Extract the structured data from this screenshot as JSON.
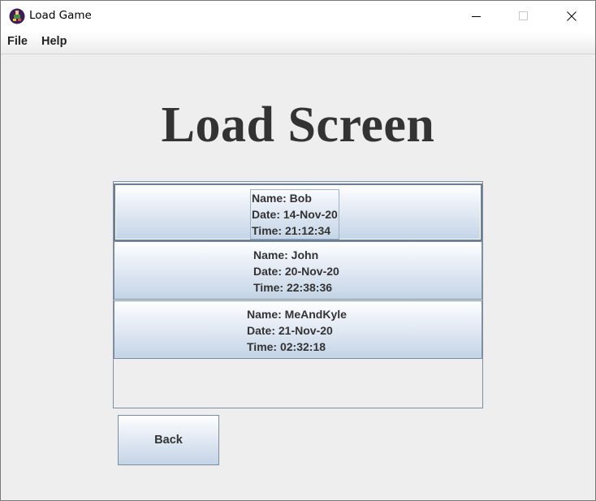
{
  "window": {
    "title": "Load Game",
    "icon": "game-app-icon",
    "controls": {
      "minimize_icon": "minimize-icon",
      "maximize_icon": "maximize-icon",
      "close_icon": "close-icon"
    }
  },
  "menu": {
    "items": [
      {
        "label": "File"
      },
      {
        "label": "Help"
      }
    ]
  },
  "heading": "Load Screen",
  "saves": [
    {
      "name": "Name: Bob",
      "date": "Date: 14-Nov-20",
      "time": "Time: 21:12:34",
      "selected": true
    },
    {
      "name": "Name: John",
      "date": "Date: 20-Nov-20",
      "time": "Time: 22:38:36",
      "selected": false
    },
    {
      "name": "Name: MeAndKyle",
      "date": "Date: 21-Nov-20",
      "time": "Time: 02:32:18",
      "selected": false
    }
  ],
  "back_button": {
    "label": "Back"
  },
  "colors": {
    "accent": "#c4d4e6",
    "border": "#7a8ea3",
    "text": "#333333"
  }
}
